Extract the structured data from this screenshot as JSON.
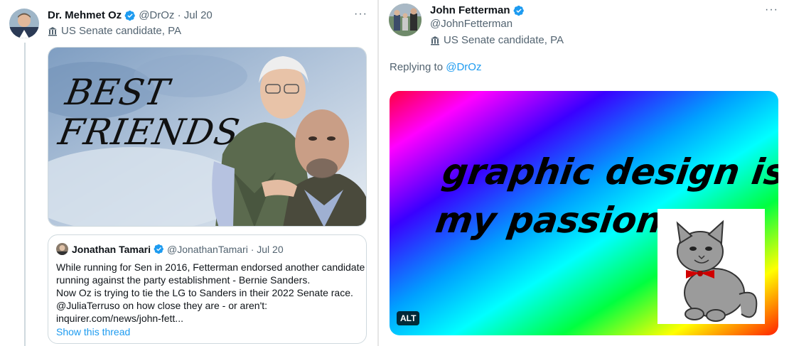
{
  "left_tweet": {
    "author_name": "Dr. Mehmet Oz",
    "handle_date": "@DrOz · Jul 20",
    "label": "US Senate candidate, PA",
    "more": "···",
    "media_text": [
      "BEST",
      "FRIENDS"
    ],
    "quote": {
      "author_name": "Jonathan Tamari",
      "handle_date": "@JonathanTamari · Jul 20",
      "body_lines": [
        "While running for Sen in 2016, Fetterman endorsed another candidate",
        "running against the party establishment - Bernie Sanders.",
        "Now Oz is trying to tie the LG to Sanders in their 2022 Senate race.",
        "@JuliaTerruso on how close they are - or aren't:",
        "inquirer.com/news/john-fett..."
      ],
      "show_thread": "Show this thread"
    }
  },
  "right_tweet": {
    "author_name": "John Fetterman",
    "handle": "@JohnFetterman",
    "label": "US Senate candidate, PA",
    "more": "···",
    "replying_prefix": "Replying to",
    "replying_handle": "@DrOz",
    "media_text_line1": "graphic design is",
    "media_text_line2": "my passion.",
    "alt_badge": "ALT"
  },
  "colors": {
    "verified": "#1d9bf0",
    "link": "#1d9bf0",
    "secondary_text": "#536471"
  }
}
